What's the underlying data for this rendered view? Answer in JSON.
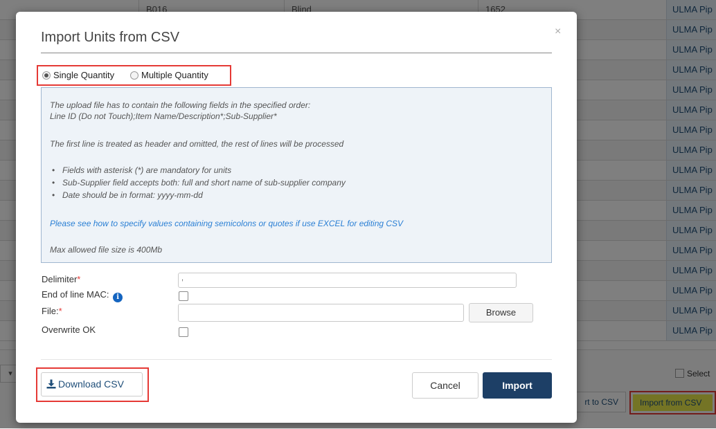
{
  "background": {
    "first_row": {
      "code": "B016",
      "type": "Blind",
      "number": "1652"
    },
    "ulma_label": "ULMA Pip",
    "select_label": "Select",
    "export_label": "rt to CSV",
    "import_label": "Import from CSV"
  },
  "modal": {
    "title": "Import Units from CSV",
    "close_glyph": "×",
    "quantity": {
      "single_label": "Single Quantity",
      "multiple_label": "Multiple Quantity",
      "selected": "single"
    },
    "info": {
      "line1": "The upload file has to contain the following fields in the specified order:",
      "line2": "Line ID (Do not Touch);Item Name/Description*;Sub-Supplier*",
      "line3": "The first line is treated as header and omitted, the rest of lines will be processed",
      "bullets": [
        "Fields with asterisk (*) are mandatory for units",
        "Sub-Supplier field accepts both: full and short name of sub-supplier company",
        "Date should be in format: yyyy-mm-dd"
      ],
      "link": "Please see how to specify values containing semicolons or quotes if use EXCEL for editing CSV",
      "max_size": "Max allowed file size is 400Mb"
    },
    "form": {
      "delimiter_label": "Delimiter",
      "delimiter_value": ",",
      "eol_label": "End of line MAC:",
      "eol_checked": false,
      "file_label": "File:",
      "file_value": "",
      "browse_label": "Browse",
      "overwrite_label": "Overwrite OK",
      "overwrite_checked": false,
      "required_mark": "*",
      "info_glyph": "i"
    },
    "footer": {
      "download_label": "Download CSV",
      "cancel_label": "Cancel",
      "import_label": "Import"
    }
  },
  "colors": {
    "primary": "#1d3f66",
    "highlight": "#e53935",
    "link": "#2a7fd4",
    "import_highlight": "#e8e84a"
  }
}
